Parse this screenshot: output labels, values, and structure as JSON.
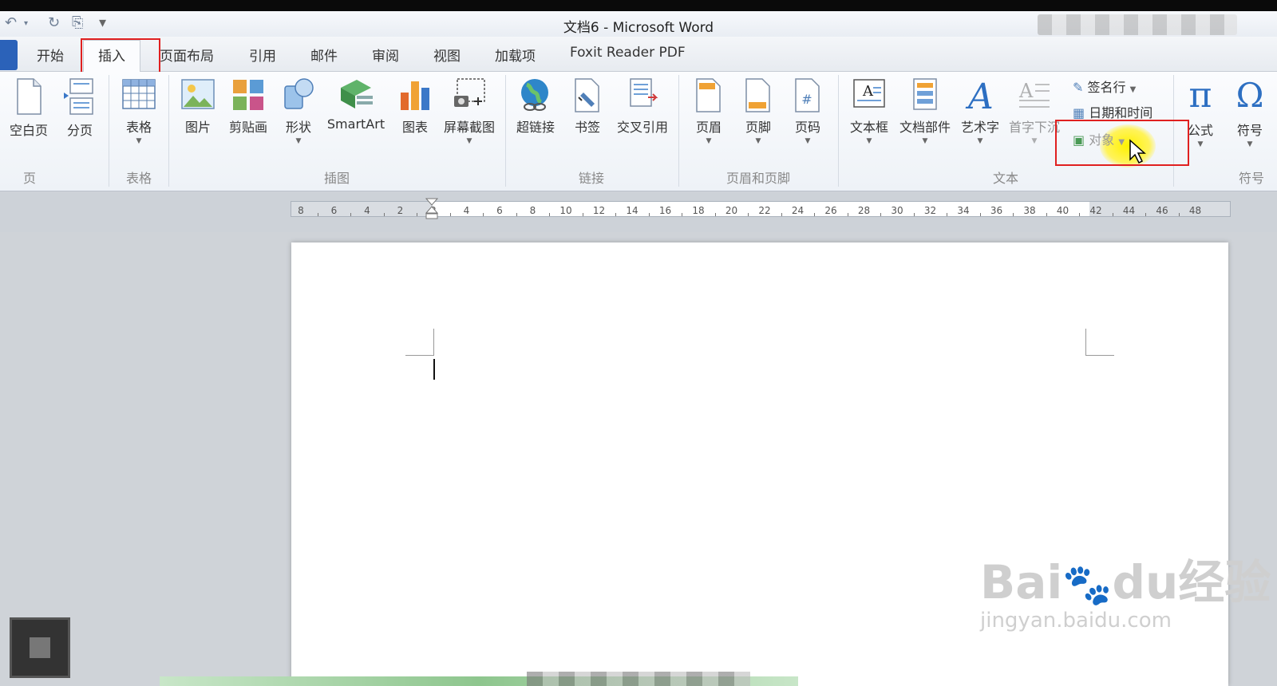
{
  "title_bar": {
    "title": "文档6  -  Microsoft Word"
  },
  "tabs": [
    {
      "label": "开始"
    },
    {
      "label": "插入"
    },
    {
      "label": "页面布局"
    },
    {
      "label": "引用"
    },
    {
      "label": "邮件"
    },
    {
      "label": "审阅"
    },
    {
      "label": "视图"
    },
    {
      "label": "加载项"
    },
    {
      "label": "Foxit Reader PDF"
    }
  ],
  "ribbon": {
    "groups": {
      "pages": "页",
      "tables": "表格",
      "illustrations": "插图",
      "links": "链接",
      "header_footer": "页眉和页脚",
      "text": "文本",
      "symbols": "符号"
    },
    "buttons": {
      "blank_page": "空白页",
      "page_break": "分页",
      "table": "表格",
      "picture": "图片",
      "clip_art": "剪贴画",
      "shapes": "形状",
      "smartart": "SmartArt",
      "chart": "图表",
      "screenshot": "屏幕截图",
      "hyperlink": "超链接",
      "bookmark": "书签",
      "cross_reference": "交叉引用",
      "header": "页眉",
      "footer": "页脚",
      "page_number": "页码",
      "text_box": "文本框",
      "quick_parts": "文档部件",
      "wordart": "艺术字",
      "drop_cap": "首字下沉",
      "signature_line": "签名行",
      "date_time": "日期和时间",
      "object": "对象",
      "equation": "公式",
      "symbol": "符号"
    }
  },
  "ruler": {
    "labels": [
      "8",
      "6",
      "4",
      "2",
      "2",
      "4",
      "6",
      "8",
      "10",
      "12",
      "14",
      "16",
      "18",
      "20",
      "22",
      "24",
      "26",
      "28",
      "30",
      "32",
      "34",
      "36",
      "38",
      "40",
      "42",
      "44",
      "46",
      "48"
    ]
  },
  "watermark": {
    "brand": "Bai",
    "du": "du",
    "cn": "经验",
    "url": "jingyan.baidu.com"
  },
  "colors": {
    "highlight_box": "#e02020",
    "file_tab": "#2b62b9",
    "cursor_highlight": "#ffee00"
  }
}
